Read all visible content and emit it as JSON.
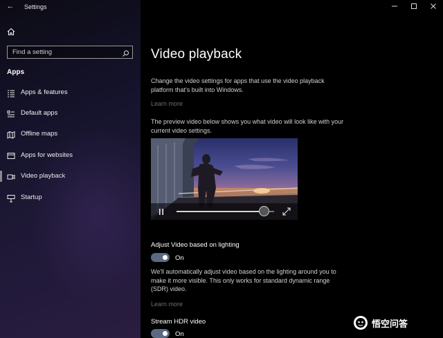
{
  "window": {
    "title": "Settings",
    "back_glyph": "←",
    "controls": [
      "minimize-icon",
      "maximize-icon",
      "close-icon"
    ]
  },
  "sidebar": {
    "home_icon": "home-icon",
    "search": {
      "placeholder": "Find a setting",
      "value": "",
      "icon": "search-icon"
    },
    "section_title": "Apps",
    "items": [
      {
        "label": "Apps & features",
        "icon": "apps-features-icon"
      },
      {
        "label": "Default apps",
        "icon": "default-apps-icon"
      },
      {
        "label": "Offline maps",
        "icon": "map-icon"
      },
      {
        "label": "Apps for websites",
        "icon": "web-apps-icon"
      },
      {
        "label": "Video playback",
        "icon": "video-icon",
        "selected": true
      },
      {
        "label": "Startup",
        "icon": "startup-icon"
      }
    ]
  },
  "main": {
    "title": "Video playback",
    "intro": "Change the video settings for apps that use the video playback platform that's built into Windows.",
    "learn_more_1": "Learn more",
    "preview_text": "The preview video below shows you what video will look like with your current video settings.",
    "player": {
      "pause_icon": "pause-icon",
      "expand_icon": "expand-icon",
      "progress": 0.9
    },
    "adjust_section": {
      "heading": "Adjust Video based on lighting",
      "toggle_state": "On",
      "description": "We'll automatically adjust video based on the lighting around you to make it more visible. This only works for standard dynamic range (SDR) video.",
      "learn_more": "Learn more"
    },
    "hdr_section": {
      "heading": "Stream HDR video",
      "toggle_state": "On"
    }
  },
  "watermark": {
    "text": "悟空问答",
    "icon": "wukong-logo-icon"
  },
  "colors": {
    "toggle_on": "#5b6a82",
    "link": "#6e6e6e",
    "accent": "#8a8a8a"
  }
}
